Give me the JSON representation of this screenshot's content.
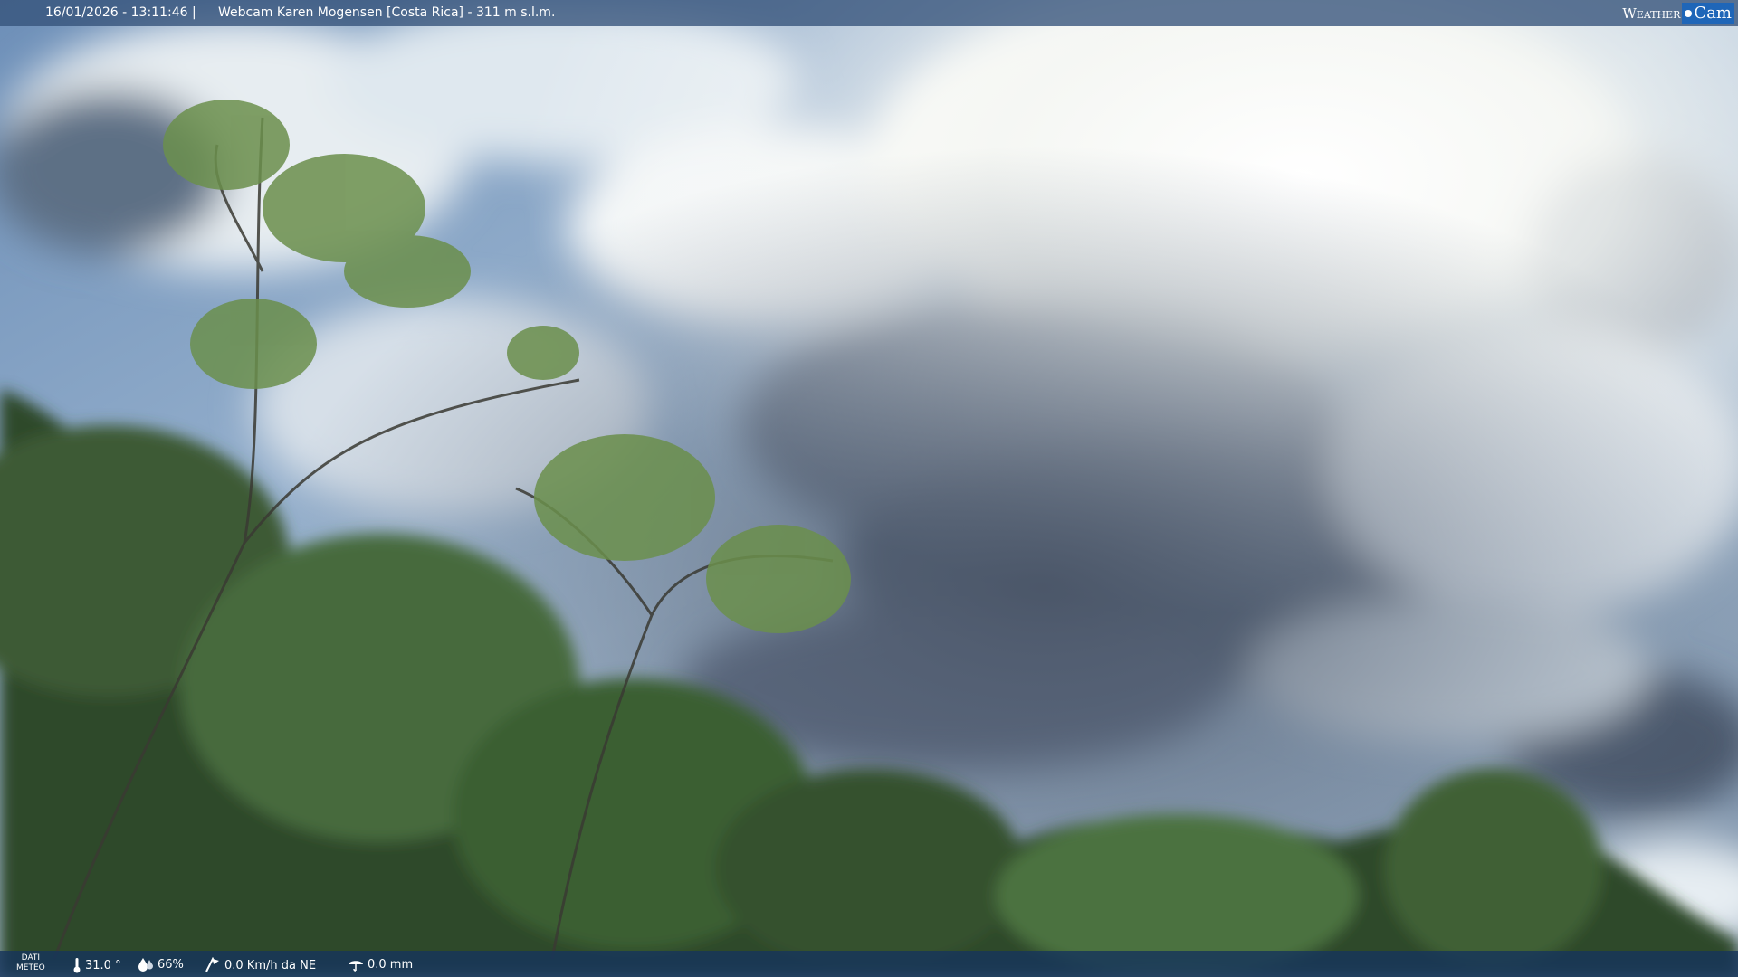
{
  "header": {
    "datetime": "16/01/2026 - 13:11:46",
    "separator": "|",
    "camera": "Webcam Karen Mogensen [Costa Rica]  - 311 m s.l.m."
  },
  "logo": {
    "part1": "Weather",
    "part2": "Cam"
  },
  "weather": {
    "label_line1": "DATI",
    "label_line2": "METEO",
    "temperature": "31.0 °",
    "humidity": "66%",
    "wind": "0.0 Km/h da NE",
    "rain": "0.0 mm"
  },
  "colors": {
    "bar": "#34527a",
    "bottom_bar": "#16345c",
    "logo_accent": "#1f66b8"
  },
  "icons": [
    "thermometer-icon",
    "humidity-icon",
    "wind-icon",
    "rain-icon"
  ]
}
